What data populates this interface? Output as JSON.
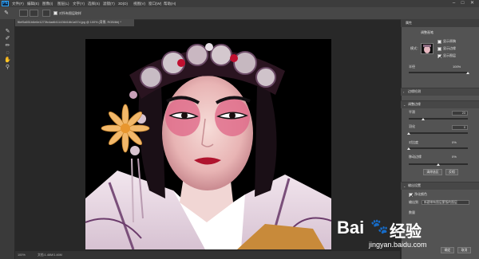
{
  "app": {
    "logo": "Ps"
  },
  "menu": [
    "文件(F)",
    "编辑(E)",
    "图像(I)",
    "图层(L)",
    "文字(Y)",
    "选择(S)",
    "滤镜(T)",
    "3D(D)",
    "视图(V)",
    "窗口(W)",
    "帮助(H)"
  ],
  "window_controls": [
    "–",
    "□",
    "✕"
  ],
  "options": {
    "brush_label": "✓",
    "sample_all_label": "对所有图层取样"
  },
  "document": {
    "tab_title": "f6ef5a551b6e6e1273fc4ad6411436416b1a57d.jpg @ 100% (背景, RGB/8#) *",
    "tab_close": "×"
  },
  "status": {
    "zoom": "100%",
    "doc_size": "文档:1.46M/1.46M"
  },
  "panel": {
    "tab_label": "属性",
    "title": "调整画笔",
    "mode_label": "模式：",
    "options": [
      "显示原稿",
      "显示边缘",
      "显示图层"
    ],
    "radius_label": "半径",
    "radius_value": "100%",
    "edge_detect_label": "边缘检测",
    "adjust_header": "调整边缘",
    "smooth_label": "平滑",
    "smooth_value": "23",
    "feather_label": "羽化",
    "feather_value": "0",
    "contrast_label": "对比度",
    "contrast_value": "0%",
    "shift_label": "移动边缘",
    "shift_value": "0%",
    "btn_refine": "清除选区",
    "btn_invert": "反相",
    "output_header": "输出设置",
    "decontam_label": "净化颜色",
    "output_to_label": "输出到",
    "output_to_value": "新建带有图层蒙版的图层",
    "amount_label": "数量",
    "ok": "确定",
    "cancel": "取消"
  },
  "watermark": {
    "brand_a": "Bai",
    "brand_b": "经验",
    "url": "jingyan.baidu.com"
  },
  "colors": {
    "accent": "#31a8ff",
    "panel_bg": "#535353",
    "workspace": "#282828"
  }
}
